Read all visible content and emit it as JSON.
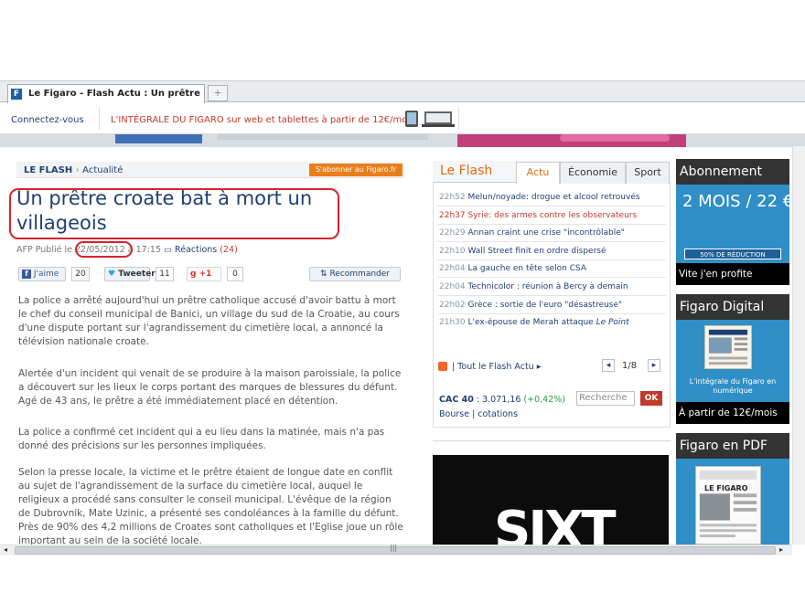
{
  "browser": {
    "tab_title": "Le Figaro - Flash Actu : Un prêtre cro...",
    "new_tab_symbol": "+"
  },
  "topbar": {
    "connect_label": "Connectez-vous",
    "promo_text": "L'INTÉGRALE DU FIGARO sur web et tablettes à partir de 12€/mois"
  },
  "article": {
    "breadcrumb_section": "LE FLASH",
    "breadcrumb_sep": "›",
    "breadcrumb_sub": "Actualité",
    "subscribe_label": "S'abonner au Figaro.fr",
    "headline": "Un prêtre croate bat à mort un villageois",
    "byline_prefix": "AFP Publié le",
    "date": "22/05/2012",
    "time": "à 17:15",
    "reactions_label": "Réactions",
    "reactions_count": "(24)",
    "social": {
      "facebook_label": "J'aime",
      "facebook_count": "20",
      "twitter_label": "Tweeter",
      "twitter_count": "11",
      "gplus_label": "+1",
      "gplus_count": "0",
      "recommend_label": "Recommander"
    },
    "paragraphs": [
      "La police a arrêté aujourd'hui un prêtre catholique accusé d'avoir battu à mort le chef du conseil municipal de Banici, un village du sud de la Croatie, au cours d'une dispute portant sur l'agrandissement du cimetière local, a annoncé la télévision nationale croate.",
      "Alertée d'un incident qui venait de se produire à la maison paroissiale, la police a découvert sur les lieux le corps portant des marques de blessures du défunt. Agé de 43 ans, le prêtre a été immédiatement placé en détention.",
      "La police a confirmé cet incident qui a eu lieu dans la matinée, mais n'a pas donné des précisions sur les personnes impliquées.",
      "Selon la presse locale, la victime et le prêtre étaient de longue date en conflit au sujet de l'agrandissement de la surface du cimetière local, auquel le religieux a procédé sans consulter le conseil municipal. L'évêque de la région de Dubrovnik, Mate Uzinic, a présenté ses condoléances à la famille du défunt. Près de 90% des 4,2 millions de Croates sont catholiques et l'Eglise joue un rôle important au sein de la société locale."
    ]
  },
  "flash": {
    "title": "Le Flash",
    "tabs": [
      "Actu",
      "Économie",
      "Sport"
    ],
    "items": [
      {
        "time": "22h52",
        "text": "Melun/noyade: drogue et alcool retrouvés",
        "hot": false
      },
      {
        "time": "22h37",
        "text": "Syrie: des armes contre les observateurs",
        "hot": true
      },
      {
        "time": "22h29",
        "text": "Annan craint une crise \"incontrôlable\"",
        "hot": false
      },
      {
        "time": "22h10",
        "text": "Wall Street finit en ordre dispersé",
        "hot": false
      },
      {
        "time": "22h04",
        "text": "La gauche en tête selon CSA",
        "hot": false
      },
      {
        "time": "22h04",
        "text": "Technicolor : réunion à Bercy à demain",
        "hot": false
      },
      {
        "time": "22h02",
        "text": "Grèce : sortie de l'euro \"désastreuse\"",
        "hot": false
      },
      {
        "time": "21h30",
        "text": "L'ex-épouse de Merah attaque ",
        "emph": "Le Point",
        "hot": false
      }
    ],
    "footer_label": "| Tout le Flash Actu ▸",
    "page_label": "1/8",
    "prev_symbol": "◂",
    "next_symbol": "▸",
    "cac_label": "CAC 40",
    "cac_value": ": 3.071,16",
    "cac_change": "(+0,42%)",
    "search_placeholder": "Recherche",
    "ok_label": "OK",
    "bourse_label": "Bourse | cotations"
  },
  "ad": {
    "brand": "SIXT"
  },
  "sidebar": {
    "abonnement_title": "Abonnement",
    "abonnement_price": "2 MOIS / 22 €",
    "abonnement_badge": "50% DE RÉDUCTION",
    "abonnement_cta": "Vite j'en profite",
    "digital_title": "Figaro Digital",
    "digital_text": "L'intégrale du Figaro en numérique",
    "digital_cta": "À partir de 12€/mois",
    "pdf_title": "Figaro en PDF",
    "pdf_masthead": "LE FIGARO"
  },
  "colors": {
    "brand_blue": "#1f3f73",
    "flash_orange": "#e46a10",
    "highlight_red": "#d8232a",
    "promo_blue": "#2f8fc6"
  }
}
